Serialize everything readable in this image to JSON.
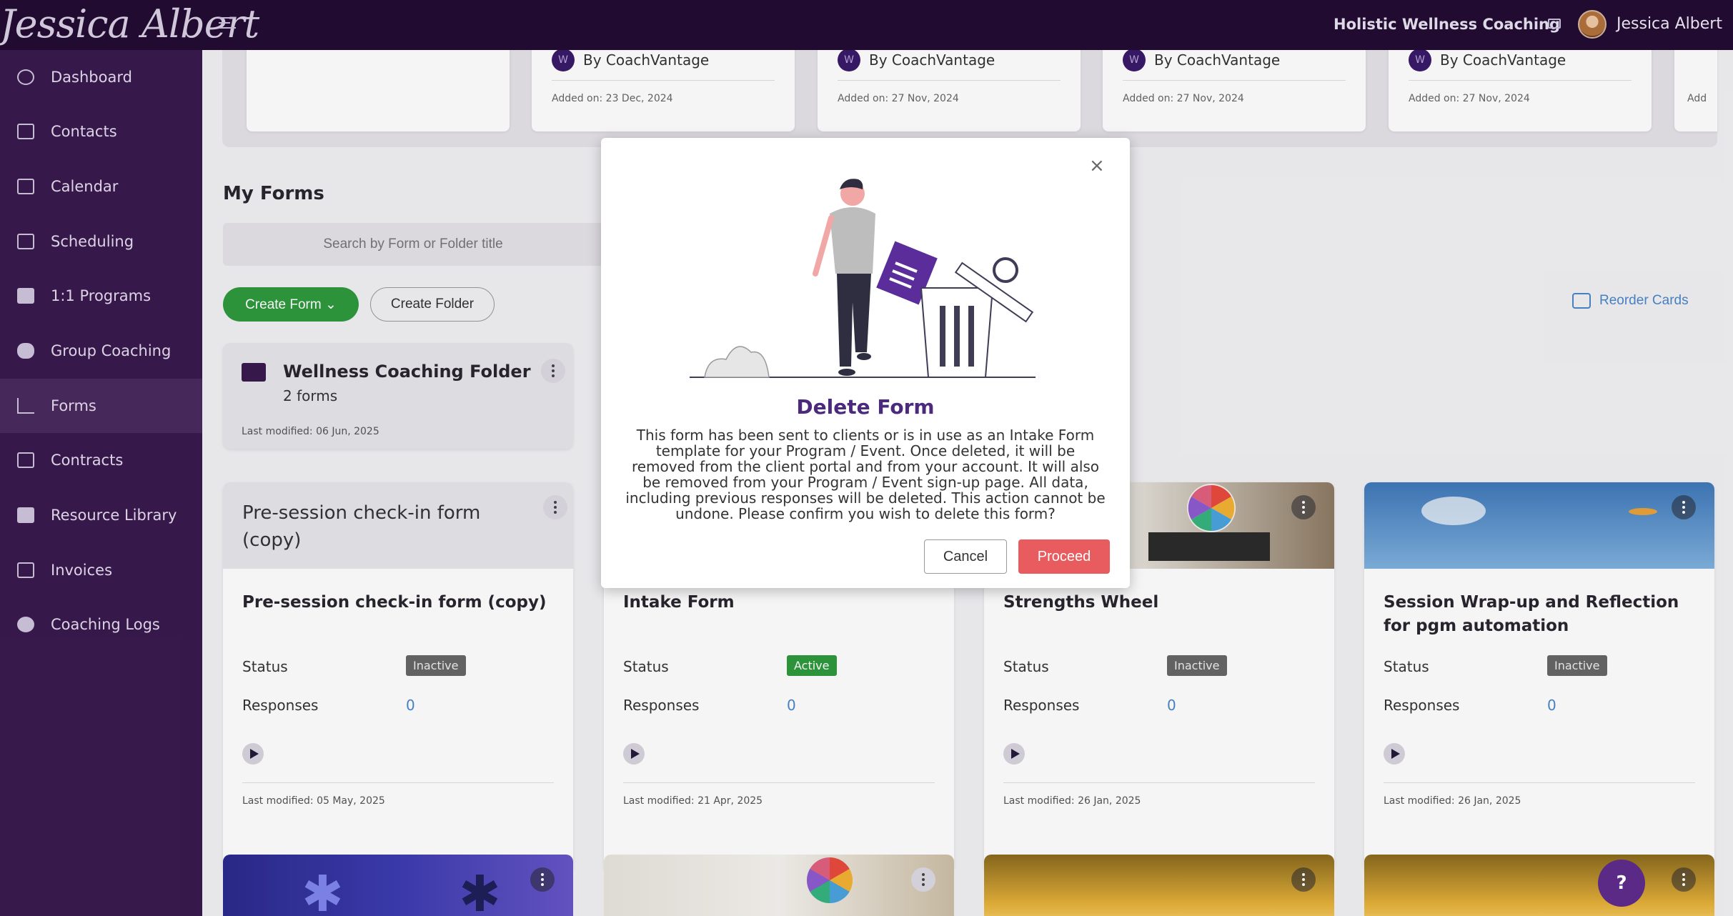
{
  "topbar": {
    "brand": "Jessica Albert",
    "company": "Holistic Wellness Coaching",
    "user": "Jessica Albert"
  },
  "sidebar": {
    "items": [
      {
        "label": "Dashboard",
        "icon": "dashboard-icon"
      },
      {
        "label": "Contacts",
        "icon": "contacts-icon"
      },
      {
        "label": "Calendar",
        "icon": "calendar-icon"
      },
      {
        "label": "Scheduling",
        "icon": "scheduling-icon"
      },
      {
        "label": "1:1 Programs",
        "icon": "programs-icon"
      },
      {
        "label": "Group Coaching",
        "icon": "group-icon"
      },
      {
        "label": "Forms",
        "icon": "forms-icon"
      },
      {
        "label": "Contracts",
        "icon": "contracts-icon"
      },
      {
        "label": "Resource Library",
        "icon": "library-icon"
      },
      {
        "label": "Invoices",
        "icon": "invoices-icon"
      },
      {
        "label": "Coaching Logs",
        "icon": "clock-icon"
      }
    ],
    "active": "Forms"
  },
  "templates": [
    {
      "by": "By CoachVantage",
      "added": "Added on: 23 Dec, 2024"
    },
    {
      "by": "By CoachVantage",
      "added": "Added on: 27 Nov, 2024"
    },
    {
      "by": "By CoachVantage",
      "added": "Added on: 27 Nov, 2024"
    },
    {
      "by": "By CoachVantage",
      "added": "Added on: 27 Nov, 2024"
    },
    {
      "by": "",
      "added": "Add"
    }
  ],
  "forms_section": {
    "heading": "My Forms",
    "search_placeholder": "Search by Form or Folder title",
    "create_form": "Create Form",
    "create_folder": "Create Folder",
    "reorder": "Reorder Cards"
  },
  "folder": {
    "name": "Wellness Coaching Folder",
    "count": "2 forms",
    "modified": "Last modified: 06 Jun, 2025"
  },
  "labels": {
    "status": "Status",
    "responses": "Responses"
  },
  "forms": [
    {
      "header": "Pre-session check-in form (copy)",
      "title": "Pre-session check-in form (copy)",
      "status": "Inactive",
      "responses": "0",
      "modified": "Last modified: 05 May, 2025"
    },
    {
      "header": "",
      "title": "Intake Form",
      "status": "Active",
      "responses": "0",
      "modified": "Last modified: 21 Apr, 2025"
    },
    {
      "header": "",
      "title": "Strengths Wheel",
      "status": "Inactive",
      "responses": "0",
      "modified": "Last modified: 26 Jan, 2025"
    },
    {
      "header": "",
      "title": "Session Wrap-up and Reflection for pgm automation",
      "status": "Inactive",
      "responses": "0",
      "modified": "Last modified: 26 Jan, 2025"
    }
  ],
  "modal": {
    "title": "Delete Form",
    "message": "This form has been sent to clients or is in use as an Intake Form template for your Program / Event. Once deleted, it will be removed from the client portal and from your account. It will also be removed from your Program / Event sign-up page. All data, including previous responses will be deleted. This action cannot be undone. Please confirm you wish to delete this form?",
    "cancel": "Cancel",
    "proceed": "Proceed"
  },
  "help": {
    "label": "?"
  },
  "colors": {
    "topbar": "#230c33",
    "sidebar": "#3a1a4f",
    "accent_green": "#2f9a3e",
    "danger": "#e85c5f",
    "modal_title": "#4b2a7e",
    "link": "#4a86c9"
  }
}
